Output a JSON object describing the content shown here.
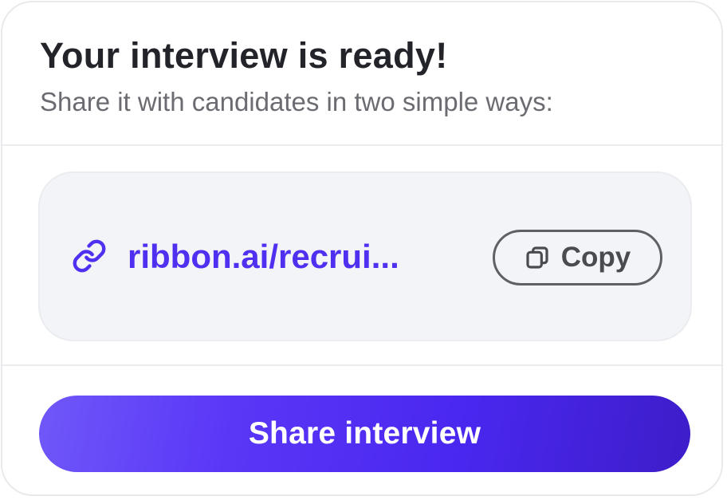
{
  "header": {
    "title": "Your interview is ready!",
    "subtitle": "Share it with candidates in two simple ways:"
  },
  "link_panel": {
    "link_icon": "link-icon",
    "link_text": "ribbon.ai/recrui...",
    "copy_icon": "copy-icon",
    "copy_label": "Copy"
  },
  "share": {
    "label": "Share interview"
  },
  "colors": {
    "accent": "#4f2ff0",
    "button_gradient_start": "#6f58f8",
    "button_gradient_end": "#3d1dc9",
    "title": "#232429",
    "subtitle": "#6b6c72",
    "panel_bg": "#f3f4f7"
  }
}
